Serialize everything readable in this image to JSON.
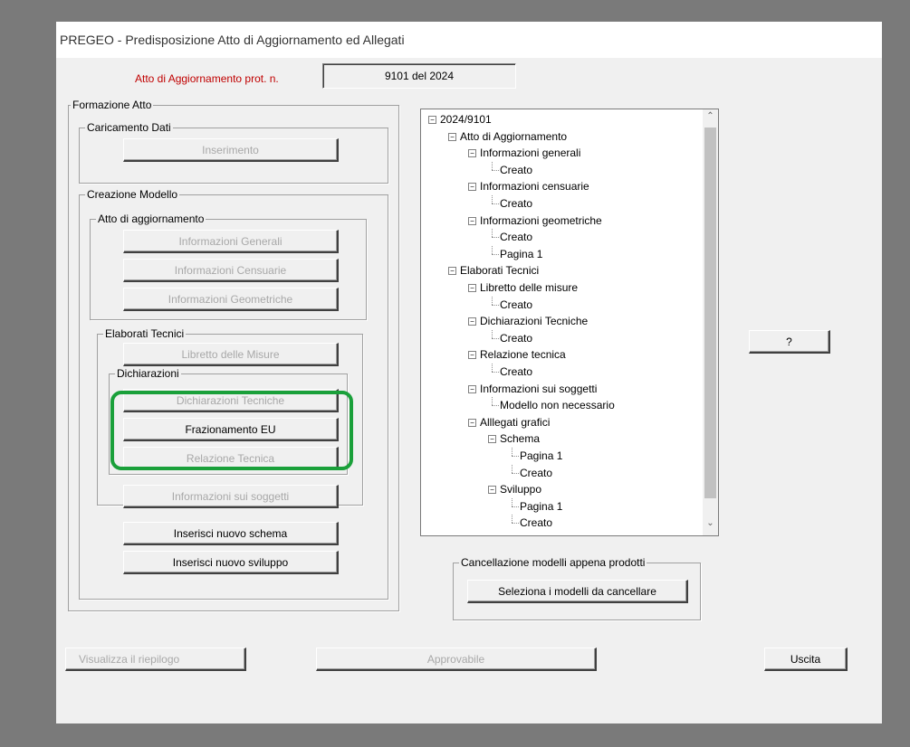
{
  "window": {
    "title": "PREGEO - Predisposizione Atto di Aggiornamento ed Allegati"
  },
  "header": {
    "prot_label": "Atto di Aggiornamento prot. n.",
    "prot_value": "9101 del 2024"
  },
  "formazione": {
    "label": "Formazione Atto",
    "caricamento": {
      "label": "Caricamento Dati",
      "inserimento": "Inserimento"
    },
    "creazione": {
      "label": "Creazione Modello",
      "atto": {
        "label": "Atto di aggiornamento",
        "generali": "Informazioni Generali",
        "censuarie": "Informazioni Censuarie",
        "geometriche": "Informazioni Geometriche"
      },
      "elaborati": {
        "label": "Elaborati Tecnici",
        "libretto": "Libretto delle Misure",
        "dichiarazioni": {
          "label": "Dichiarazioni",
          "tecniche": "Dichiarazioni Tecniche",
          "frazionamento": "Frazionamento EU",
          "relazione": "Relazione Tecnica"
        },
        "soggetti": "Informazioni sui soggetti"
      },
      "nuovo_schema": "Inserisci nuovo schema",
      "nuovo_sviluppo": "Inserisci nuovo sviluppo"
    }
  },
  "tree": {
    "nodes": [
      "2024/9101",
      "Atto di Aggiornamento",
      "Informazioni generali",
      "Creato",
      "Informazioni censuarie",
      "Creato",
      "Informazioni geometriche",
      "Creato",
      "Pagina 1",
      "Elaborati Tecnici",
      "Libretto delle misure",
      "Creato",
      "Dichiarazioni Tecniche",
      "Creato",
      "Relazione tecnica",
      "Creato",
      "Informazioni sui soggetti",
      "Modello non necessario",
      "Alllegati grafici",
      "Schema",
      "Pagina 1",
      "Creato",
      "Sviluppo",
      "Pagina 1",
      "Creato"
    ]
  },
  "help_button": "?",
  "cancellazione": {
    "label": "Cancellazione modelli appena prodotti",
    "button": "Seleziona i modelli da cancellare"
  },
  "footer": {
    "riepilogo": "Visualizza il riepilogo",
    "approvabile": "Approvabile",
    "uscita": "Uscita"
  },
  "colors": {
    "highlight": "#1aa03a",
    "prot_label": "#c00000"
  },
  "scrollbar": {
    "up_icon": "chevron-up-icon",
    "down_icon": "chevron-down-icon"
  }
}
